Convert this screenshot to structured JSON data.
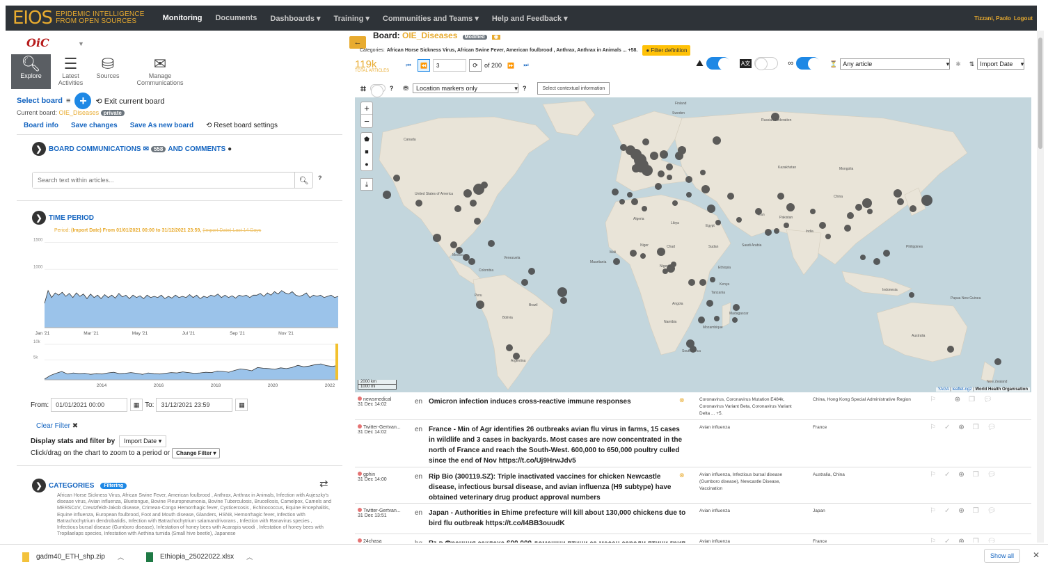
{
  "app": {
    "logo_main": "EIOS",
    "logo_line1": "Epidemic Intelligence",
    "logo_line2": "from open sources",
    "brand_color": "#e8ab2f",
    "nav": [
      "Monitoring",
      "Documents",
      "Dashboards ▾",
      "Training ▾",
      "Communities and Teams ▾",
      "Help and Feedback ▾"
    ],
    "user_name": "Tizzani, Paolo",
    "logout": "Logout"
  },
  "left": {
    "org_logo": "OiC",
    "tools": [
      {
        "label": "Explore",
        "icon": "search-icon"
      },
      {
        "label": "Latest Activities",
        "icon": "list-icon"
      },
      {
        "label": "Sources",
        "icon": "database-icon"
      },
      {
        "label": "Manage Communications",
        "icon": "envelope-icon"
      }
    ],
    "select_board": "Select board",
    "exit_board": "Exit current board",
    "current_board_label": "Current board:",
    "current_board_name": "OIE_Diseases",
    "private": "private",
    "board_info": "Board info",
    "save_changes": "Save changes",
    "save_as_new": "Save As new board",
    "reset": "Reset board settings",
    "comms_a": "Board communications",
    "comms_count": "558",
    "comms_b": "and comments",
    "search_placeholder": "Search text within articles...",
    "time_period": "Time period",
    "period_prefix": "Period:",
    "period_text": "(Import Date) From 01/01/2021 00:00 to 31/12/2021 23:59,",
    "period_struck": "(Import Date) Last 14 Days",
    "from_label": "From:",
    "from_value": "01/01/2021 00:00",
    "to_label": "To:",
    "to_value": "31/12/2021 23:59",
    "clear_filter": "Clear Filter",
    "display_stats": "Display stats and filter by",
    "display_value": "Import Date",
    "click_drag": "Click/drag on the chart to zoom to a period or",
    "change_filter": "Change Filter",
    "categories": "Categories",
    "filtering": "Filtering",
    "categories_text": "African Horse Sickness Virus, African Swine Fever, American foulbrood , Anthrax, Anthrax in Animals, Infection with Aujeszky's disease virus, Avian influenza, Bluetongue, Bovine Pleuropneumonia, Bovine Tuberculosis, Brucellosis, Camelpox, Camels and MERSCoV, Creutzfeldt-Jakob disease, Crimean-Congo Hemorrhagic fever, Cysticercosis , Echinococcus, Equine Encephalitis, Equine influenza, European foulbrood, Foot and Mouth disease, Glanders, HSN8, Hemorrhagic fever, Infection with Batrachochytrium dendrobatidis, Infection with Batrachochytrium salamandrivorans , Infection with Ranavirus species , Infectious bursal disease (Gumboro disease), Infestation of honey bees with Acarapis woodi , Infestation of honey bees with Tropilaelaps species, Infestation with Aethina tumida (Small hive beetle), Japanese"
  },
  "chart_data": [
    {
      "type": "area",
      "ylim": [
        0,
        1500
      ],
      "yticks": [
        "1500",
        "1000"
      ],
      "xticks": [
        "Jan '21",
        "Mar '21",
        "May '21",
        "Jul '21",
        "Sep '21",
        "Nov '21"
      ],
      "values": [
        420,
        640,
        520,
        600,
        560,
        610,
        540,
        590,
        520,
        600,
        540,
        580,
        500,
        580,
        520,
        560,
        500,
        570,
        520,
        560,
        510,
        590,
        530,
        560,
        500,
        560,
        520,
        550,
        500,
        560,
        520,
        540,
        520,
        560,
        500,
        540,
        510,
        560,
        520,
        540,
        520,
        570,
        520,
        560,
        500,
        540,
        520,
        560,
        540,
        580,
        520,
        560,
        520,
        550,
        510,
        560,
        540,
        560,
        520,
        560,
        560,
        590,
        540,
        600,
        560,
        620,
        580,
        640,
        600,
        580,
        620,
        560,
        540,
        560,
        600,
        520,
        560,
        540,
        560,
        520,
        540,
        560,
        520,
        540
      ],
      "color": "#8ab8e6"
    },
    {
      "type": "area",
      "ylim": [
        0,
        10000
      ],
      "yticks": [
        "10k",
        "5k"
      ],
      "xticks": [
        "2014",
        "2016",
        "2018",
        "2020",
        "2022"
      ],
      "values": [
        200,
        1200,
        1800,
        2300,
        1600,
        1900,
        1700,
        1800,
        1500,
        1700,
        1600,
        1900,
        2100,
        1700,
        1800,
        2000,
        1800,
        1500,
        1900,
        1700,
        1600,
        1800,
        2000,
        1900,
        2200,
        2000,
        1800,
        1900,
        2100,
        2000,
        2400,
        2300,
        2100,
        2600,
        3000,
        2800,
        2500,
        3400,
        3200,
        3100,
        2900,
        3300,
        3100,
        3400,
        4000,
        3600,
        3800,
        4200,
        4400,
        3900,
        3700,
        4000
      ],
      "highlight_color": "#f2c12e",
      "color": "#8ab8e6"
    }
  ],
  "right": {
    "board_label": "Board:",
    "board_name": "OIE_Diseases",
    "modified": "Modified",
    "categories_label": "Categories:",
    "categories_short": "African Horse Sickness Virus, African Swine Fever, American foulbrood , Anthrax, Anthrax in Animals ... +58.",
    "filter_def": "Filter definition",
    "total_count": "119k",
    "total_label": "Total articles",
    "page_value": "3",
    "of_pages": "of 200",
    "any_article": "Any article",
    "sort_by": "Import Date",
    "location_markers": "Location markers only",
    "contextual": "Select contextual information",
    "scale_km": "2000 km",
    "scale_mi": "1000 mi",
    "attrib_a": "YAGA",
    "attrib_b": "leaflet-ng2",
    "attrib_c": "World Health Organisation"
  },
  "map_labels": [
    "Russian Federation",
    "Kazakhstan",
    "Mongolia",
    "China",
    "India",
    "Canada",
    "United States of America",
    "Mexico",
    "Venezuela",
    "Colombia",
    "Peru",
    "Brazil",
    "Bolivia",
    "Argentina",
    "Algeria",
    "Libya",
    "Egypt",
    "Sudan",
    "Chad",
    "Niger",
    "Mali",
    "Mauritania",
    "Nigeria",
    "Ethiopia",
    "Kenya",
    "Angola",
    "Namibia",
    "South Africa",
    "Madagascar",
    "Mozambique",
    "Tanzania",
    "Australia",
    "Indonesia",
    "Philippines",
    "Papua New Guinea",
    "New Zealand",
    "Iran",
    "Pakistan",
    "Saudi Arabia",
    "Finland",
    "Sweden"
  ],
  "articles": [
    {
      "source": "newsmedical",
      "date": "31 Dec 14:02",
      "lang": "en",
      "title": "Omicron infection induces cross-reactive immune responses",
      "tags": "Coronavirus, Coronavirus Mutation E484k, Coronavirus Variant Beta, Coronavirus Variant Delta ... +5.",
      "loc": "China, Hong Kong Special Administrative Region"
    },
    {
      "source": "Twitter-Gertvan...",
      "date": "31 Dec 14:02",
      "lang": "en",
      "title": "France - Min of Agr identifies 26 outbreaks avian flu virus in farms, 15 cases in wildlife and 3 cases in backyards. Most cases are now concentrated in the north of France and reach the South-West. 600,000 to 650,000 poultry culled since the end of Nov https://t.co/Uj9HrwJdv5",
      "tags": "Avian influenza",
      "loc": "France"
    },
    {
      "source": "gphin",
      "date": "31 Dec 14:00",
      "lang": "en",
      "title": "Rip Bio (300119.SZ): Triple inactivated vaccines for chicken Newcastle disease, infectious bursal disease, and avian influenza (H9 subtype) have obtained veterinary drug product approval numbers",
      "tags": "Avian influenza, Infectious bursal disease (Gumboro disease), Newcastle Disease, Vaccination",
      "loc": "Australia, China"
    },
    {
      "source": "Twitter-Gertvan...",
      "date": "31 Dec 13:51",
      "lang": "en",
      "title": "Japan - Authorities in Ehime prefecture will kill about 130,000 chickens due to bird flu outbreak https://t.co/I4BB3ouudK",
      "tags": "Avian influenza",
      "loc": "Japan"
    },
    {
      "source": "24chasa",
      "date": "",
      "lang": "bg",
      "title": "Във Франция заклаха 600 000 домашни птици за месец заради птичи грип",
      "tags": "Avian influenza",
      "loc": "France"
    }
  ],
  "downloads": {
    "file1": "gadm40_ETH_shp.zip",
    "file2": "Ethiopia_25022022.xlsx",
    "show_all": "Show all"
  }
}
